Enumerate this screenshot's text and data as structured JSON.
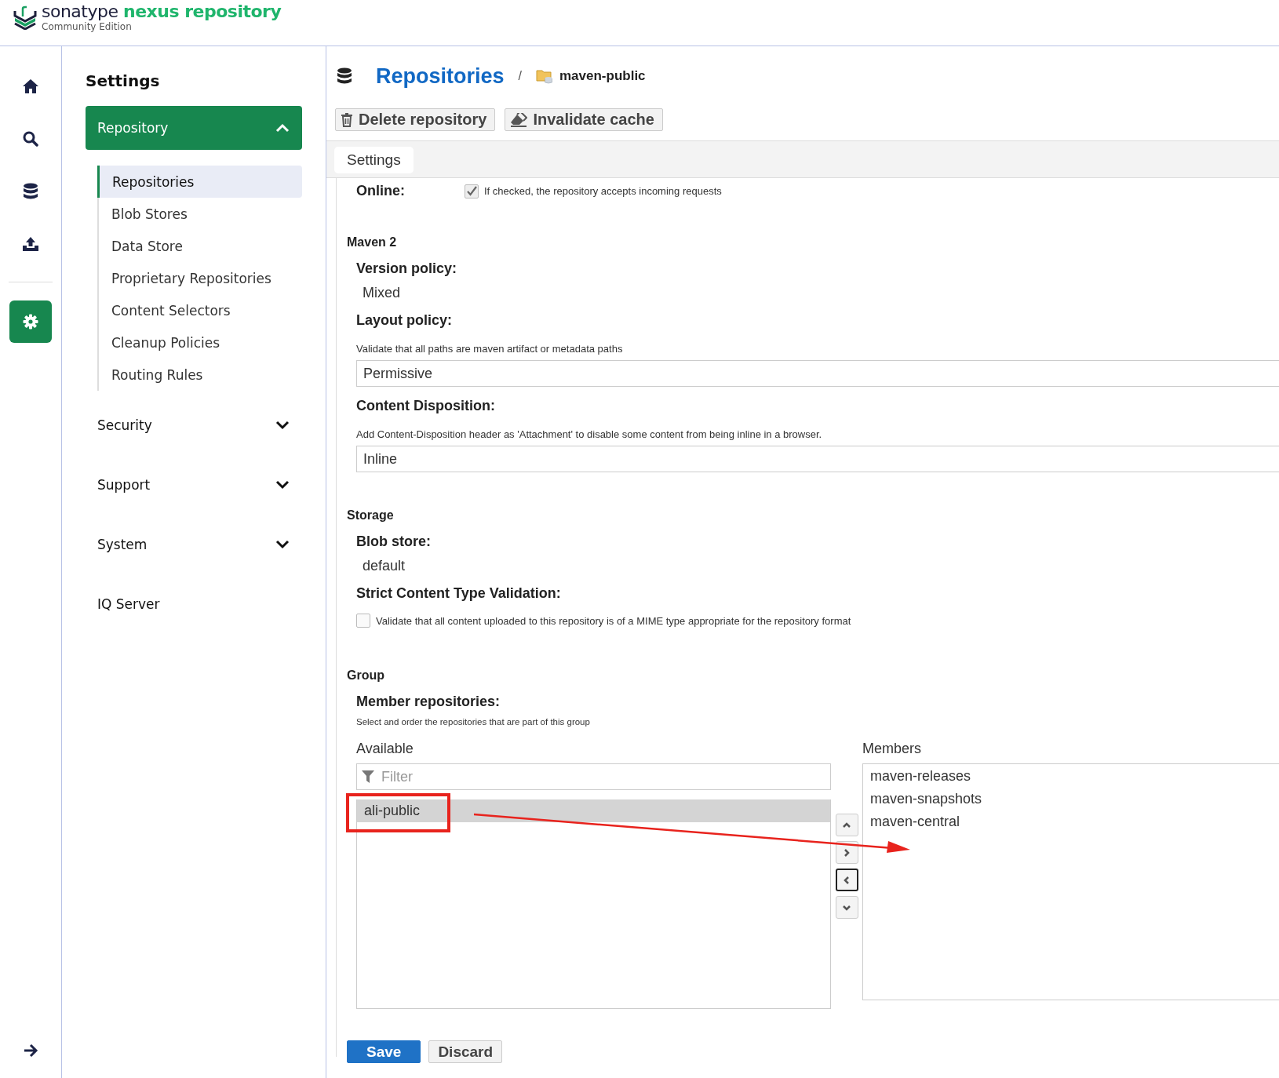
{
  "header": {
    "brand": "sonatype",
    "product": "nexus repository",
    "edition": "Community Edition"
  },
  "rail": {
    "items": [
      {
        "kind": "home",
        "selected": false
      },
      {
        "kind": "search",
        "selected": false
      },
      {
        "kind": "database",
        "selected": false
      },
      {
        "kind": "upload",
        "selected": false
      },
      {
        "kind": "settings",
        "selected": true
      }
    ]
  },
  "sidebar": {
    "title": "Settings",
    "sections": [
      {
        "label": "Repository",
        "kind": "group",
        "selected": true,
        "expanded": true,
        "children": [
          {
            "label": "Repositories",
            "selected": true
          },
          {
            "label": "Blob Stores",
            "selected": false
          },
          {
            "label": "Data Store",
            "selected": false
          },
          {
            "label": "Proprietary Repositories",
            "selected": false
          },
          {
            "label": "Content Selectors",
            "selected": false
          },
          {
            "label": "Cleanup Policies",
            "selected": false
          },
          {
            "label": "Routing Rules",
            "selected": false
          }
        ]
      },
      {
        "label": "Security",
        "kind": "group",
        "selected": false,
        "expanded": false
      },
      {
        "label": "Support",
        "kind": "group",
        "selected": false,
        "expanded": false
      },
      {
        "label": "System",
        "kind": "group",
        "selected": false,
        "expanded": false
      },
      {
        "label": "IQ Server",
        "kind": "link",
        "selected": false
      }
    ]
  },
  "breadcrumb": {
    "title": "Repositories",
    "separator": "/",
    "current": "maven-public"
  },
  "toolbar": {
    "buttons": [
      {
        "label": "Delete repository",
        "kind": "delete"
      },
      {
        "label": "Invalidate cache",
        "kind": "invalidate"
      }
    ]
  },
  "tabs": [
    {
      "label": "Settings",
      "selected": true
    }
  ],
  "form": {
    "online": {
      "label": "Online:",
      "checked": true,
      "hint": "If checked, the repository accepts incoming requests"
    },
    "sections": [
      {
        "title": "Maven 2",
        "fields": [
          {
            "kind": "text",
            "label": "Version policy:",
            "value": "Mixed"
          },
          {
            "kind": "select",
            "label": "Layout policy:",
            "hint": "Validate that all paths are maven artifact or metadata paths",
            "value": "Permissive"
          },
          {
            "kind": "select",
            "label": "Content Disposition:",
            "hint": "Add Content-Disposition header as 'Attachment' to disable some content from being inline in a browser.",
            "value": "Inline"
          }
        ]
      },
      {
        "title": "Storage",
        "fields": [
          {
            "kind": "text",
            "label": "Blob store:",
            "value": "default"
          },
          {
            "kind": "checkbox",
            "label": "Strict Content Type Validation:",
            "hint": "Validate that all content uploaded to this repository is of a MIME type appropriate for the repository format",
            "checked": false
          }
        ]
      }
    ],
    "group": {
      "title": "Group",
      "label": "Member repositories:",
      "hint": "Select and order the repositories that are part of this group",
      "available": {
        "title": "Available",
        "placeholder": "Filter",
        "items": [
          {
            "label": "ali-public",
            "selected": true
          }
        ]
      },
      "members": {
        "title": "Members",
        "items": [
          {
            "label": "maven-releases",
            "selected": false
          },
          {
            "label": "maven-snapshots",
            "selected": false
          },
          {
            "label": "maven-central",
            "selected": false
          }
        ]
      },
      "moves": [
        {
          "kind": "up",
          "focused": false
        },
        {
          "kind": "right",
          "focused": false
        },
        {
          "kind": "left",
          "focused": true
        },
        {
          "kind": "down",
          "focused": false
        }
      ]
    }
  },
  "footer": {
    "buttons": [
      {
        "label": "Save",
        "kind": "primary"
      },
      {
        "label": "Discard",
        "kind": "secondary"
      }
    ]
  },
  "annotations": {
    "highlight_box": true,
    "arrow": true
  }
}
